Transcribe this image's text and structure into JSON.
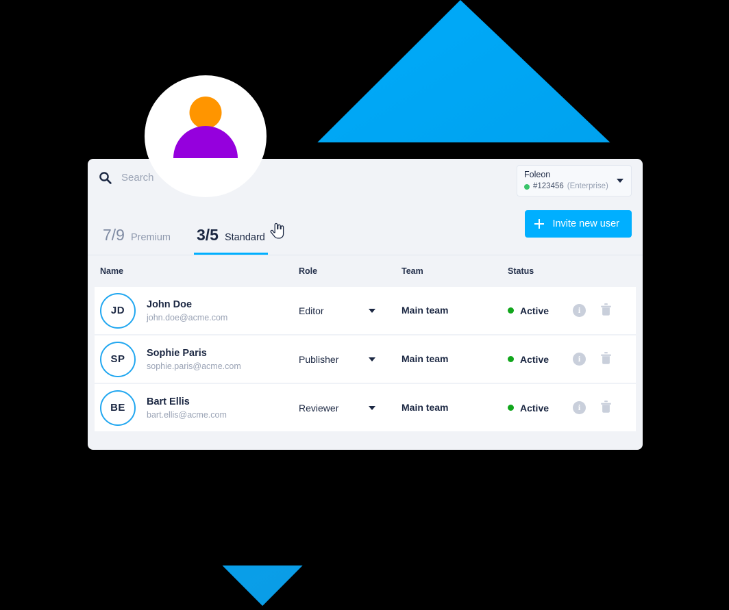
{
  "decor": {
    "avatar_badge": {
      "head_color": "#FF9500",
      "body_color": "#9500DD",
      "bubble_color": "#FFFFFF"
    },
    "diamond_color": "#00A3F0",
    "backdrop_color": "#000000"
  },
  "card": {
    "background": "#F1F3F7"
  },
  "search": {
    "placeholder": "Search",
    "value": "",
    "icon": "search-icon"
  },
  "account": {
    "name": "Foleon",
    "id": "#123456",
    "plan": "(Enterprise)",
    "status_color": "#39C46A",
    "caret_icon": "chevron-down-icon"
  },
  "tabs": [
    {
      "count": "7/9",
      "label": "Premium",
      "active": false
    },
    {
      "count": "3/5",
      "label": "Standard",
      "active": true
    }
  ],
  "invite_button": {
    "label": "Invite new user",
    "icon": "plus-icon",
    "color": "#00AFFF"
  },
  "table": {
    "headers": {
      "name": "Name",
      "role": "Role",
      "team": "Team",
      "status": "Status"
    },
    "rows": [
      {
        "initials": "JD",
        "name": "John Doe",
        "email": "john.doe@acme.com",
        "role": "Editor",
        "team": "Main team",
        "status": "Active",
        "status_color": "#11A61C"
      },
      {
        "initials": "SP",
        "name": "Sophie Paris",
        "email": "sophie.paris@acme.com",
        "role": "Publisher",
        "team": "Main team",
        "status": "Active",
        "status_color": "#11A61C"
      },
      {
        "initials": "BE",
        "name": "Bart Ellis",
        "email": "bart.ellis@acme.com",
        "role": "Reviewer",
        "team": "Main team",
        "status": "Active",
        "status_color": "#11A61C"
      }
    ],
    "row_actions": {
      "info_label": "i",
      "info_icon": "info-icon",
      "delete_icon": "trash-icon"
    }
  },
  "cursor": {
    "icon": "pointer-hand-cursor"
  }
}
